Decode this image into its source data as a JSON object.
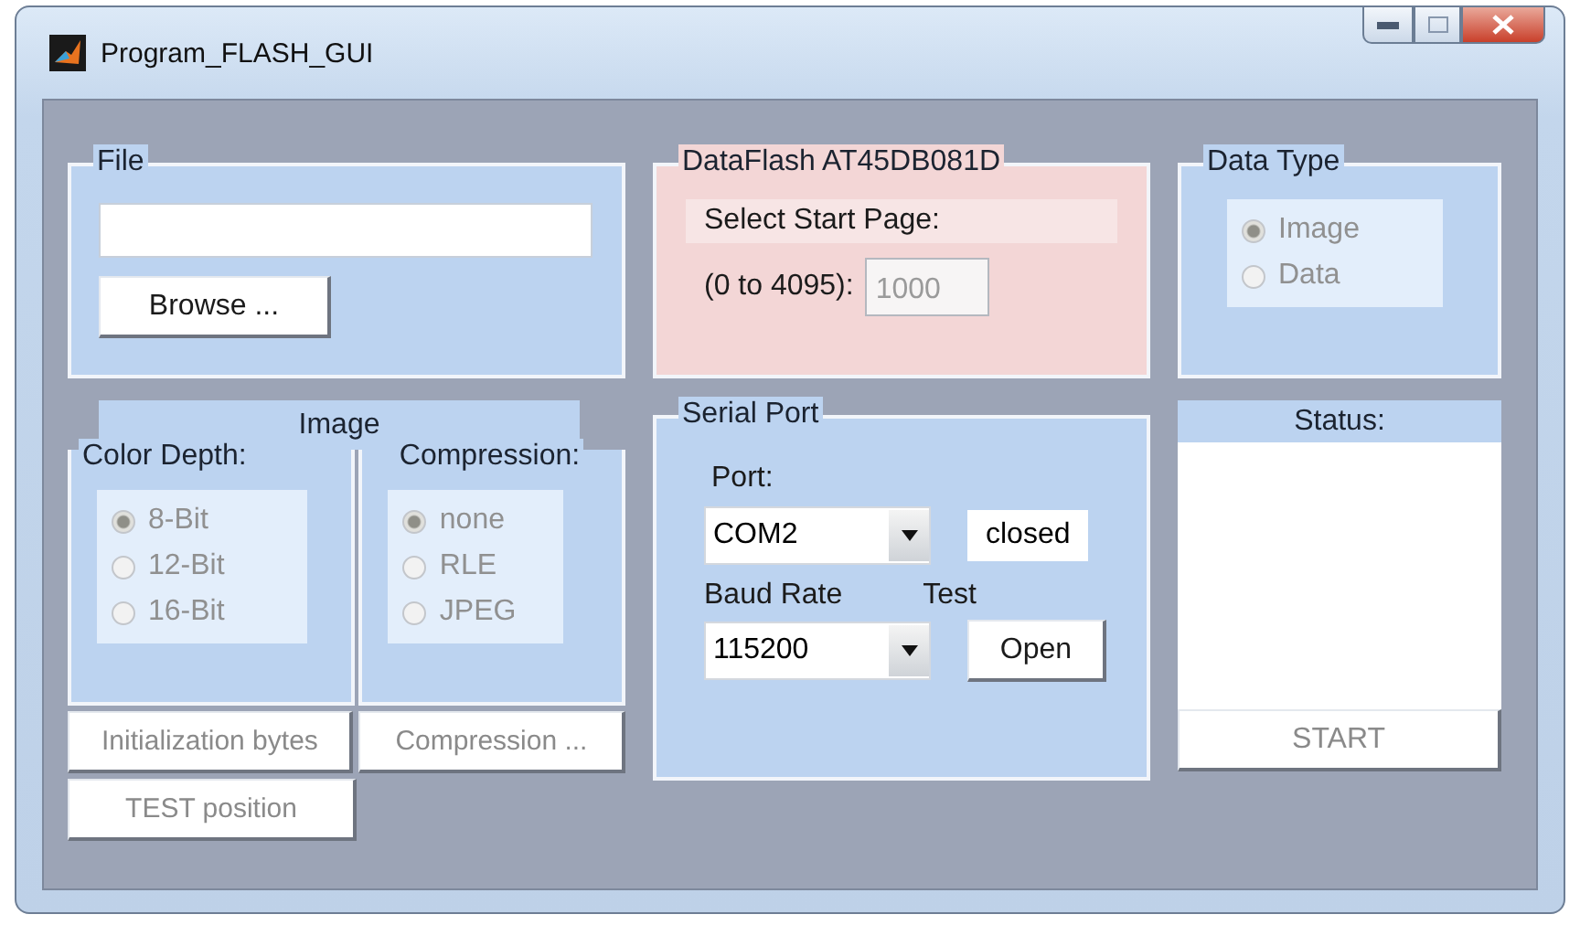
{
  "window": {
    "title": "Program_FLASH_GUI"
  },
  "file_panel": {
    "title": "File",
    "browse_button": "Browse ..."
  },
  "dataflash": {
    "title": "DataFlash AT45DB081D",
    "label_1": "Select Start Page:",
    "label_2": "(0 to 4095):",
    "start_page": {
      "value": "1000",
      "disabled": true
    }
  },
  "data_type": {
    "title": "Data Type",
    "disabled": true,
    "options": [
      {
        "label": "Image",
        "selected": true
      },
      {
        "label": "Data",
        "selected": false
      }
    ]
  },
  "image": {
    "title": "Image",
    "color_depth": {
      "title": "Color Depth:",
      "disabled": true,
      "options": [
        {
          "label": "8-Bit",
          "selected": true
        },
        {
          "label": "12-Bit",
          "selected": false
        },
        {
          "label": "16-Bit",
          "selected": false
        }
      ]
    },
    "compression": {
      "title": "Compression:",
      "disabled": true,
      "options": [
        {
          "label": "none",
          "selected": true
        },
        {
          "label": "RLE",
          "selected": false
        },
        {
          "label": "JPEG",
          "selected": false
        }
      ]
    },
    "buttons": [
      {
        "label": "Initialization bytes",
        "disabled": true
      },
      {
        "label": "Compression ...",
        "disabled": true
      },
      {
        "label": "TEST position",
        "disabled": true
      }
    ]
  },
  "serial_port": {
    "title": "Serial Port",
    "port_label": "Port:",
    "port": "COM2",
    "state": "closed",
    "baud_label": "Baud Rate",
    "baud": "115200",
    "test_label": "Test",
    "open_button": "Open"
  },
  "status": {
    "title": "Status:",
    "start_button": {
      "label": "START",
      "disabled": true
    }
  }
}
